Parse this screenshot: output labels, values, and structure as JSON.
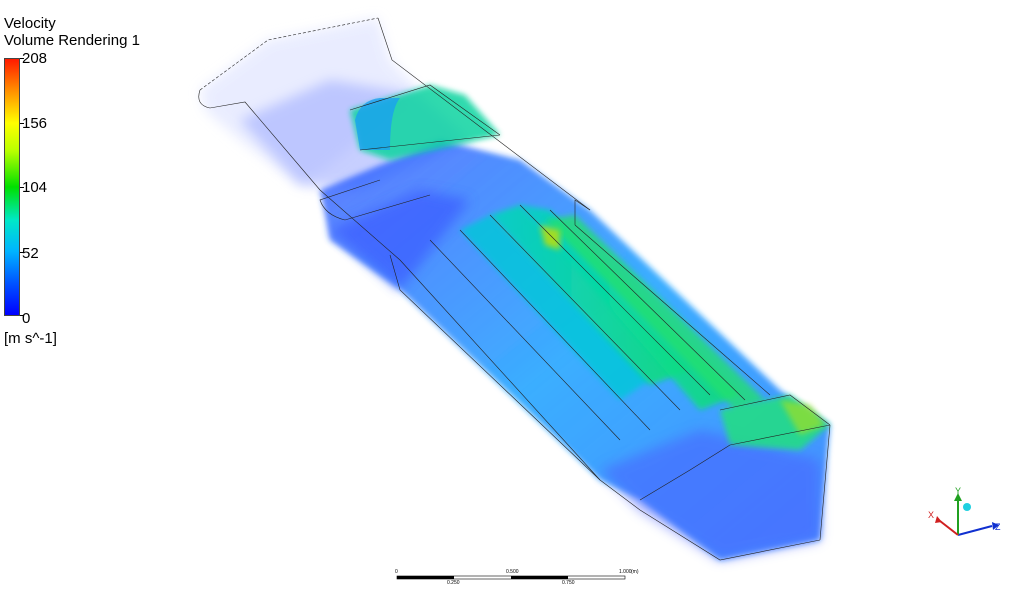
{
  "legend": {
    "title": "Velocity",
    "subtitle": "Volume Rendering 1",
    "max": "208",
    "tick_156": "156",
    "tick_104": "104",
    "tick_52": "52",
    "min": "0",
    "units": "[m s^-1]",
    "colormap": [
      "#0000ff",
      "#0050ff",
      "#00b4ff",
      "#00e8c8",
      "#00e000",
      "#b8ff00",
      "#ffff00",
      "#ff8c00",
      "#ff1a00"
    ]
  },
  "scale_bar": {
    "label_0": "0",
    "label_0_500": "0.500",
    "label_1_000": "1.000",
    "unit": "(m)",
    "label_0_250": "0.250",
    "label_0_750": "0.750"
  },
  "axes": {
    "x_label": "X",
    "y_label": "Y",
    "z_label": "Z",
    "x_color": "#d02020",
    "y_color": "#20a020",
    "z_color": "#1030d0"
  }
}
